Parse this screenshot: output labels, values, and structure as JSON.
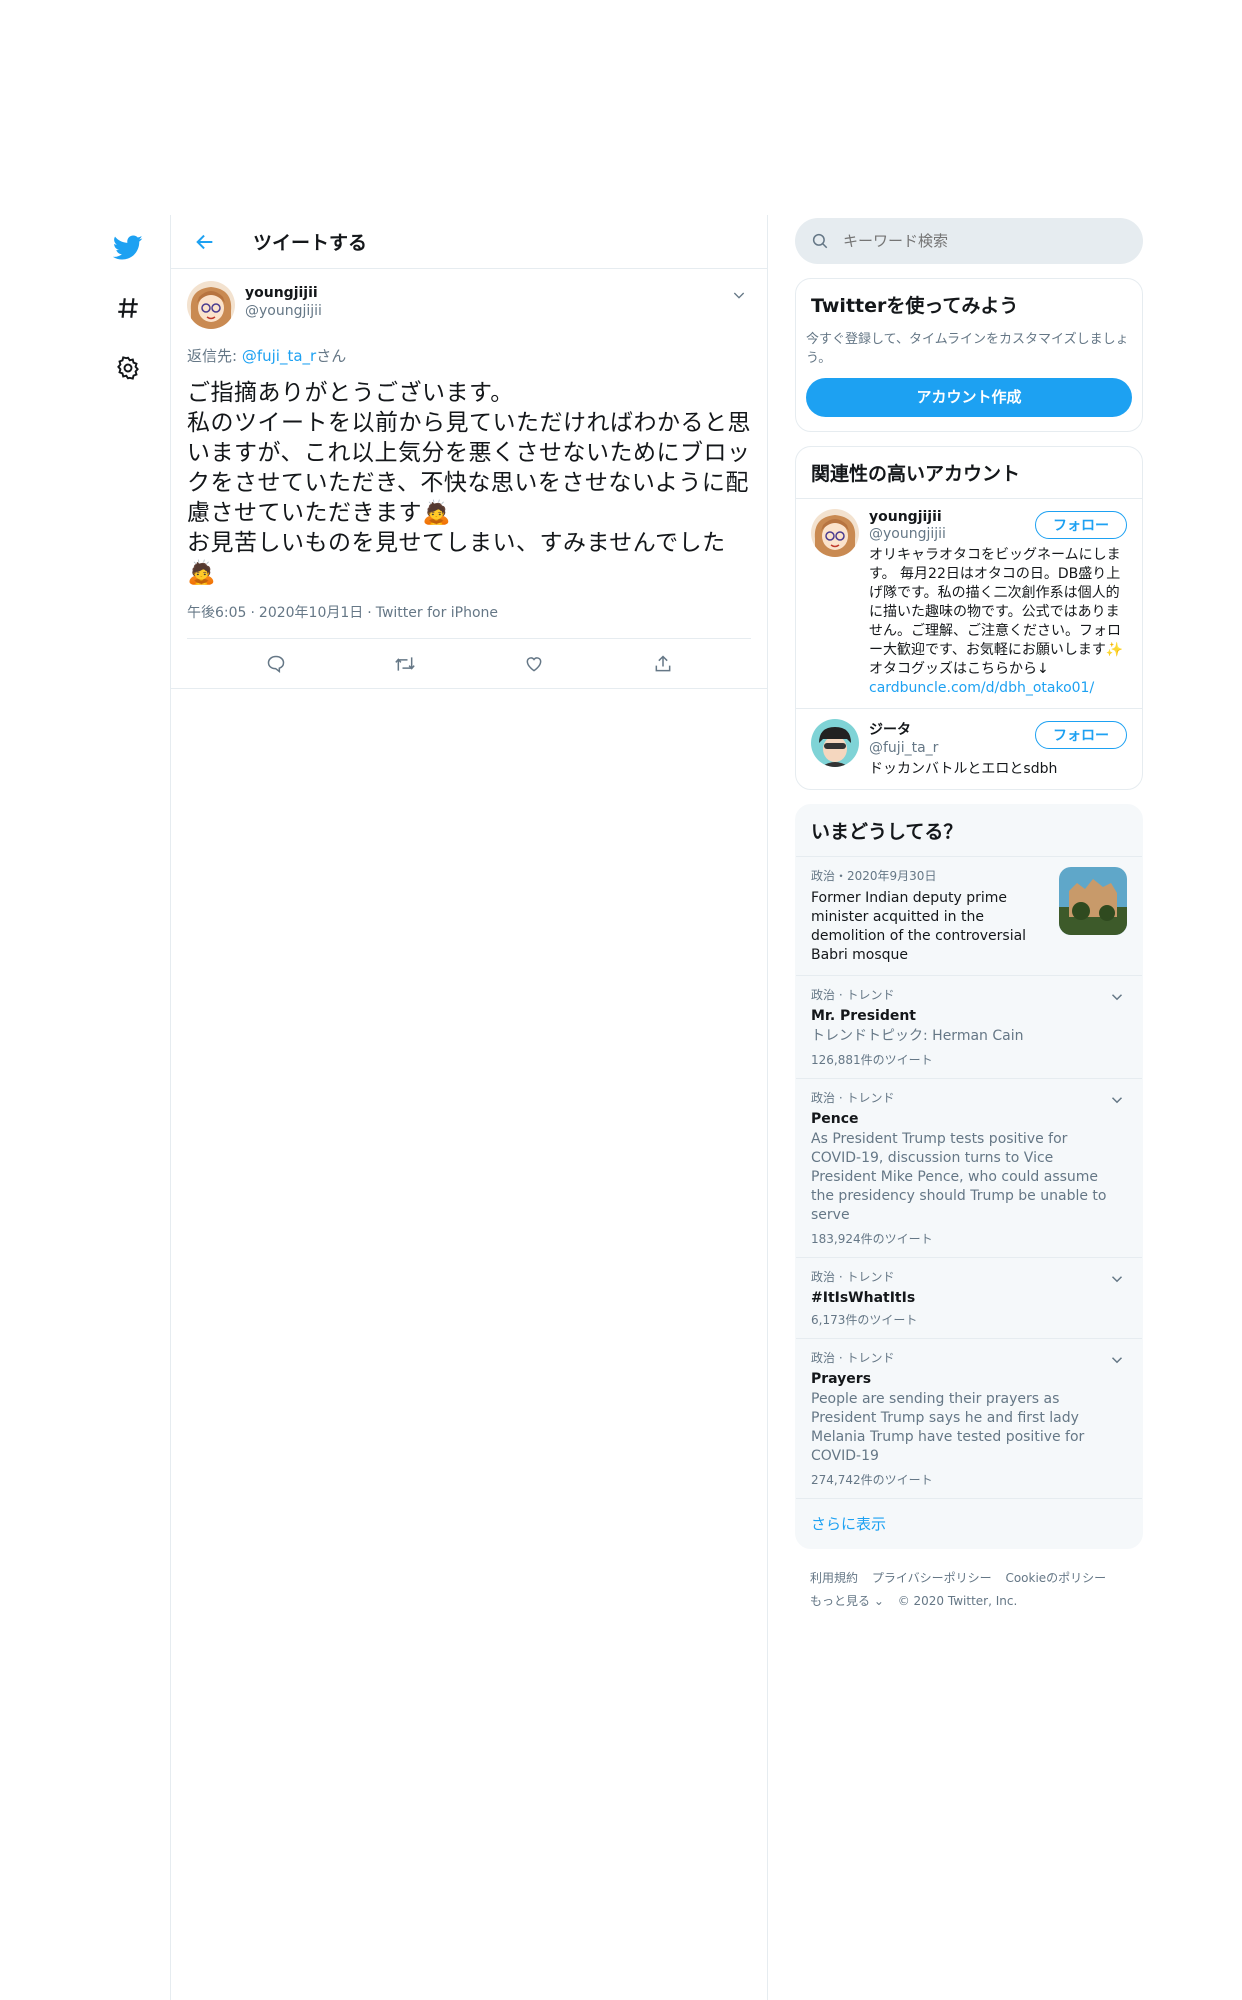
{
  "nav": {
    "icons": [
      "twitter-bird-icon",
      "hashtag-icon",
      "settings-gear-icon"
    ]
  },
  "main": {
    "title": "ツイートする",
    "tweet": {
      "author_name": "youngjijii",
      "author_handle": "@youngjijii",
      "reply_prefix": "返信先: ",
      "reply_handle": "@fuji_ta_r",
      "reply_suffix": "さん",
      "body": "ご指摘ありがとうございます。\n私のツイートを以前から見ていただければわかると思いますが、これ以上気分を悪くさせないためにブロックをさせていただき、不快な思いをさせないように配慮させていただきます🙇\nお見苦しいものを見せてしまい、すみませんでした🙇",
      "time": "午後6:05",
      "date": "2020年10月1日",
      "source": "Twitter for iPhone"
    }
  },
  "side": {
    "search_placeholder": "キーワード検索",
    "signup": {
      "title": "Twitterを使ってみよう",
      "subtitle": "今すぐ登録して、タイムラインをカスタマイズしましょう。",
      "button": "アカウント作成"
    },
    "related": {
      "title": "関連性の高いアカウント",
      "users": [
        {
          "name": "youngjijii",
          "handle": "@youngjijii",
          "bio": "オリキャラオタコをビッグネームにします。 毎月22日はオタコの日。DB盛り上げ隊です。私の描く二次創作系は個人的に描いた趣味の物です。公式ではありません。ご理解、ご注意ください。フォロー大歓迎です、お気軽にお願いします✨オタコグッズはこちらから↓ ",
          "link": "cardbuncle.com/d/dbh_otako01/",
          "follow": "フォロー"
        },
        {
          "name": "ジータ",
          "handle": "@fuji_ta_r",
          "bio": "ドッカンバトルとエロとsdbh",
          "link": "",
          "follow": "フォロー"
        }
      ]
    },
    "trends": {
      "title": "いまどうしてる？",
      "news": {
        "meta": "政治・2020年9月30日",
        "title": "Former Indian deputy prime minister acquitted in the demolition of the controversial Babri mosque"
      },
      "items": [
        {
          "meta": "政治 · トレンド",
          "name": "Mr. President",
          "desc": "トレンドトピック: Herman Cain",
          "count": "126,881件のツイート"
        },
        {
          "meta": "政治 · トレンド",
          "name": "Pence",
          "desc": "As President Trump tests positive for COVID-19, discussion turns to Vice President Mike Pence, who could assume the presidency should Trump be unable to serve",
          "count": "183,924件のツイート"
        },
        {
          "meta": "政治 · トレンド",
          "name": "#ItIsWhatItIs",
          "desc": "",
          "count": "6,173件のツイート"
        },
        {
          "meta": "政治 · トレンド",
          "name": "Prayers",
          "desc": "People are sending their prayers as President Trump says he and first lady Melania Trump have tested positive for COVID-19",
          "count": "274,742件のツイート"
        }
      ],
      "show_more": "さらに表示"
    },
    "footer": {
      "terms": "利用規約",
      "privacy": "プライバシーポリシー",
      "cookie": "Cookieのポリシー",
      "more": "もっと見る ⌄",
      "copyright": "© 2020 Twitter, Inc."
    }
  },
  "colors": {
    "accent": "#1da1f2",
    "border": "#e6ecf0",
    "muted": "#657786"
  }
}
